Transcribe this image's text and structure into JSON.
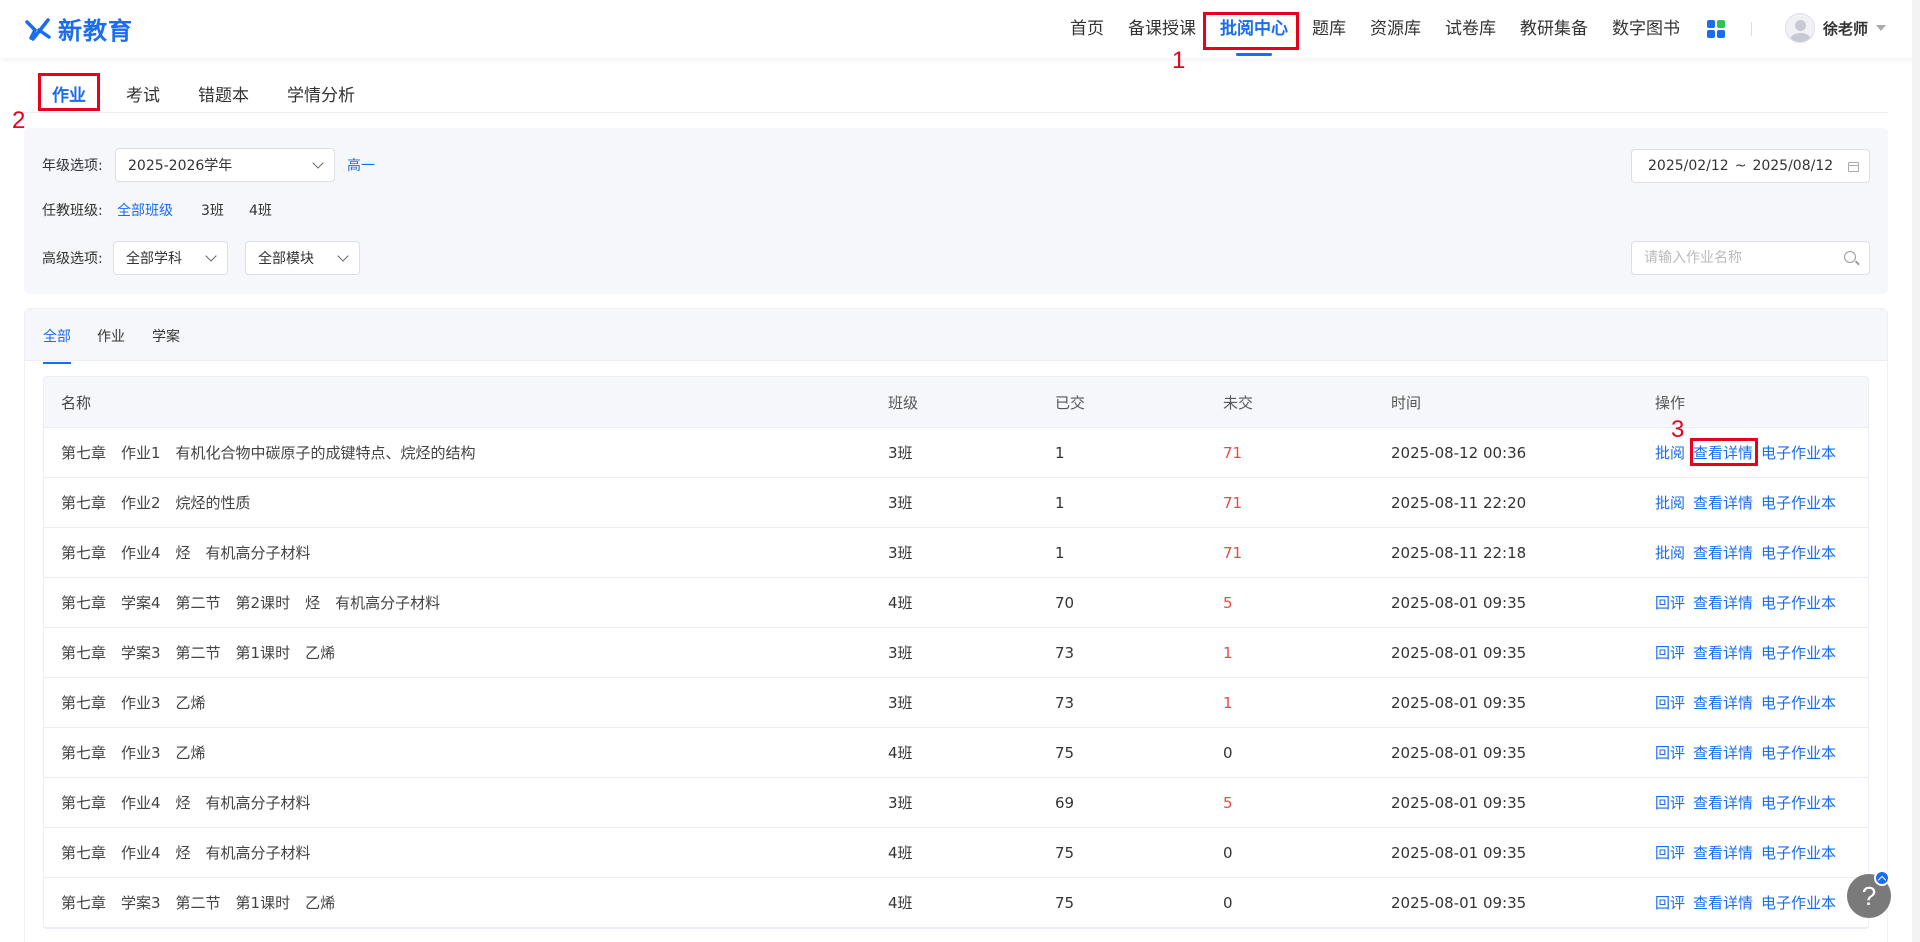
{
  "header": {
    "logo_text": "新教育",
    "nav": [
      "首页",
      "备课授课",
      "批阅中心",
      "题库",
      "资源库",
      "试卷库",
      "教研集备",
      "数字图书"
    ],
    "active_nav": "批阅中心",
    "user_name": "徐老师"
  },
  "subtabs": {
    "items": [
      "作业",
      "考试",
      "错题本",
      "学情分析"
    ],
    "active": "作业"
  },
  "filters": {
    "grade_label": "年级选项:",
    "grade_value": "2025-2026学年",
    "grade_level": "高一",
    "class_label": "任教班级:",
    "class_options": [
      "全部班级",
      "3班",
      "4班"
    ],
    "class_active": "全部班级",
    "advanced_label": "高级选项:",
    "subject_select": "全部学科",
    "module_select": "全部模块",
    "date_start": "2025/02/12",
    "date_sep": "~",
    "date_end": "2025/08/12",
    "search_placeholder": "请输入作业名称"
  },
  "content_tabs": {
    "items": [
      "全部",
      "作业",
      "学案"
    ],
    "active": "全部"
  },
  "table": {
    "headers": [
      "名称",
      "班级",
      "已交",
      "未交",
      "时间",
      "操作"
    ],
    "rows": [
      {
        "name": "第七章　作业1　有机化合物中碳原子的成键特点、烷烃的结构",
        "class": "3班",
        "submitted": "1",
        "unsubmitted": "71",
        "time": "2025-08-12 00:36",
        "ops": [
          "批阅",
          "查看详情",
          "电子作业本"
        ]
      },
      {
        "name": "第七章　作业2　烷烃的性质",
        "class": "3班",
        "submitted": "1",
        "unsubmitted": "71",
        "time": "2025-08-11 22:20",
        "ops": [
          "批阅",
          "查看详情",
          "电子作业本"
        ]
      },
      {
        "name": "第七章　作业4　烃　有机高分子材料",
        "class": "3班",
        "submitted": "1",
        "unsubmitted": "71",
        "time": "2025-08-11 22:18",
        "ops": [
          "批阅",
          "查看详情",
          "电子作业本"
        ]
      },
      {
        "name": "第七章　学案4　第二节　第2课时　烃　有机高分子材料",
        "class": "4班",
        "submitted": "70",
        "unsubmitted": "5",
        "time": "2025-08-01 09:35",
        "ops": [
          "回评",
          "查看详情",
          "电子作业本"
        ]
      },
      {
        "name": "第七章　学案3　第二节　第1课时　乙烯",
        "class": "3班",
        "submitted": "73",
        "unsubmitted": "1",
        "time": "2025-08-01 09:35",
        "ops": [
          "回评",
          "查看详情",
          "电子作业本"
        ]
      },
      {
        "name": "第七章　作业3　乙烯",
        "class": "3班",
        "submitted": "73",
        "unsubmitted": "1",
        "time": "2025-08-01 09:35",
        "ops": [
          "回评",
          "查看详情",
          "电子作业本"
        ]
      },
      {
        "name": "第七章　作业3　乙烯",
        "class": "4班",
        "submitted": "75",
        "unsubmitted": "0",
        "time": "2025-08-01 09:35",
        "ops": [
          "回评",
          "查看详情",
          "电子作业本"
        ]
      },
      {
        "name": "第七章　作业4　烃　有机高分子材料",
        "class": "3班",
        "submitted": "69",
        "unsubmitted": "5",
        "time": "2025-08-01 09:35",
        "ops": [
          "回评",
          "查看详情",
          "电子作业本"
        ]
      },
      {
        "name": "第七章　作业4　烃　有机高分子材料",
        "class": "4班",
        "submitted": "75",
        "unsubmitted": "0",
        "time": "2025-08-01 09:35",
        "ops": [
          "回评",
          "查看详情",
          "电子作业本"
        ]
      },
      {
        "name": "第七章　学案3　第二节　第1课时　乙烯",
        "class": "4班",
        "submitted": "75",
        "unsubmitted": "0",
        "time": "2025-08-01 09:35",
        "ops": [
          "回评",
          "查看详情",
          "电子作业本"
        ]
      }
    ]
  },
  "annotations": [
    "1",
    "2",
    "3"
  ],
  "help_label": "?",
  "colors": {
    "accent": "#1a6cf0",
    "annotation": "#e8001c",
    "warning_number": "#e84a4a"
  }
}
